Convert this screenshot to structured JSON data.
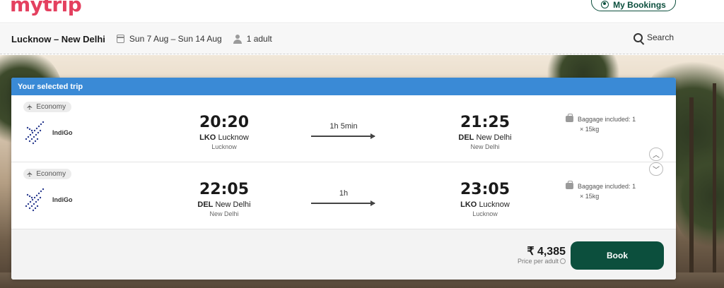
{
  "header": {
    "logo_text": "mytrip",
    "my_bookings_label": "My Bookings"
  },
  "search_summary": {
    "route": "Lucknow – New Delhi",
    "dates": "Sun 7 Aug – Sun 14 Aug",
    "passengers": "1 adult",
    "search_label": "Search"
  },
  "trip": {
    "title": "Your selected trip",
    "legs": [
      {
        "cabin": "Economy",
        "airline": "IndiGo",
        "depart_time": "20:20",
        "depart_code": "LKO",
        "depart_place": "Lucknow",
        "depart_city": "Lucknow",
        "duration": "1h 5min",
        "arrive_time": "21:25",
        "arrive_code": "DEL",
        "arrive_place": "New Delhi",
        "arrive_city": "New Delhi",
        "baggage_line1": "Baggage included: 1",
        "baggage_line2": "× 15kg"
      },
      {
        "cabin": "Economy",
        "airline": "IndiGo",
        "depart_time": "22:05",
        "depart_code": "DEL",
        "depart_place": "New Delhi",
        "depart_city": "New Delhi",
        "duration": "1h",
        "arrive_time": "23:05",
        "arrive_code": "LKO",
        "arrive_place": "Lucknow",
        "arrive_city": "Lucknow",
        "baggage_line1": "Baggage included: 1",
        "baggage_line2": "× 15kg"
      }
    ]
  },
  "pricing": {
    "price": "₹ 4,385",
    "price_note": "Price per adult",
    "book_label": "Book"
  },
  "colors": {
    "brand": "#e4405f",
    "header_bar": "#3a8ad6",
    "primary_button": "#0c4f3d"
  }
}
